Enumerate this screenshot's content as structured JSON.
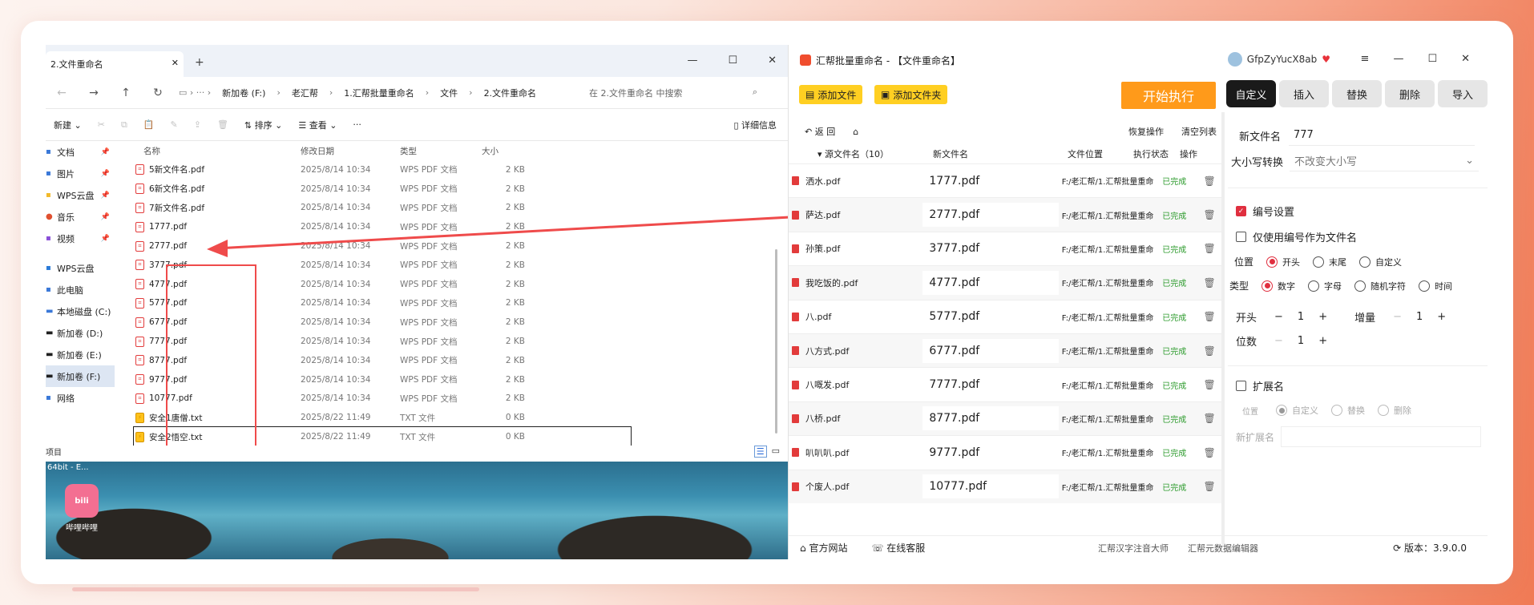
{
  "explorer": {
    "tab_title": "2.文件重命名",
    "tab_close": "✕",
    "new_tab": "+",
    "window_buttons": [
      "—",
      "☐",
      "✕"
    ],
    "breadcrumbs": [
      "新加卷 (F:)",
      "老汇帮",
      "1.汇帮批量重命名",
      "文件",
      "2.文件重命名"
    ],
    "search_placeholder": "在 2.文件重命名 中搜索",
    "commands": {
      "new": "新建",
      "sort": "排序",
      "view": "查看",
      "more": "···",
      "details": "详细信息"
    },
    "sidebar": [
      {
        "label": "文档",
        "icon": "document-icon",
        "pinned": true
      },
      {
        "label": "图片",
        "icon": "picture-icon",
        "pinned": true
      },
      {
        "label": "WPS云盘",
        "icon": "folder-icon",
        "pinned": true
      },
      {
        "label": "音乐",
        "icon": "music-icon",
        "pinned": true
      },
      {
        "label": "视频",
        "icon": "video-icon",
        "pinned": true
      },
      {
        "label": "WPS云盘",
        "icon": "cloud-icon",
        "pinned": false
      },
      {
        "label": "此电脑",
        "icon": "pc-icon",
        "pinned": false
      },
      {
        "label": "本地磁盘 (C:)",
        "icon": "drive-icon",
        "pinned": false
      },
      {
        "label": "新加卷 (D:)",
        "icon": "drive-icon",
        "pinned": false
      },
      {
        "label": "新加卷 (E:)",
        "icon": "drive-icon",
        "pinned": false
      },
      {
        "label": "新加卷 (F:)",
        "icon": "drive-icon",
        "pinned": false
      },
      {
        "label": "网络",
        "icon": "network-icon",
        "pinned": false
      }
    ],
    "columns": [
      "名称",
      "修改日期",
      "类型",
      "大小"
    ],
    "files": [
      {
        "name": "5新文件名.pdf",
        "date": "2025/8/14 10:34",
        "type": "WPS PDF 文档",
        "size": "2 KB",
        "kind": "pdf"
      },
      {
        "name": "6新文件名.pdf",
        "date": "2025/8/14 10:34",
        "type": "WPS PDF 文档",
        "size": "2 KB",
        "kind": "pdf"
      },
      {
        "name": "7新文件名.pdf",
        "date": "2025/8/14 10:34",
        "type": "WPS PDF 文档",
        "size": "2 KB",
        "kind": "pdf"
      },
      {
        "name": "1777.pdf",
        "date": "2025/8/14 10:34",
        "type": "WPS PDF 文档",
        "size": "2 KB",
        "kind": "pdf"
      },
      {
        "name": "2777.pdf",
        "date": "2025/8/14 10:34",
        "type": "WPS PDF 文档",
        "size": "2 KB",
        "kind": "pdf"
      },
      {
        "name": "3777.pdf",
        "date": "2025/8/14 10:34",
        "type": "WPS PDF 文档",
        "size": "2 KB",
        "kind": "pdf"
      },
      {
        "name": "4777.pdf",
        "date": "2025/8/14 10:34",
        "type": "WPS PDF 文档",
        "size": "2 KB",
        "kind": "pdf"
      },
      {
        "name": "5777.pdf",
        "date": "2025/8/14 10:34",
        "type": "WPS PDF 文档",
        "size": "2 KB",
        "kind": "pdf"
      },
      {
        "name": "6777.pdf",
        "date": "2025/8/14 10:34",
        "type": "WPS PDF 文档",
        "size": "2 KB",
        "kind": "pdf"
      },
      {
        "name": "7777.pdf",
        "date": "2025/8/14 10:34",
        "type": "WPS PDF 文档",
        "size": "2 KB",
        "kind": "pdf"
      },
      {
        "name": "8777.pdf",
        "date": "2025/8/14 10:34",
        "type": "WPS PDF 文档",
        "size": "2 KB",
        "kind": "pdf"
      },
      {
        "name": "9777.pdf",
        "date": "2025/8/14 10:34",
        "type": "WPS PDF 文档",
        "size": "2 KB",
        "kind": "pdf"
      },
      {
        "name": "10777.pdf",
        "date": "2025/8/14 10:34",
        "type": "WPS PDF 文档",
        "size": "2 KB",
        "kind": "pdf"
      },
      {
        "name": "安全1唐僧.txt",
        "date": "2025/8/22 11:49",
        "type": "TXT 文件",
        "size": "0 KB",
        "kind": "txt"
      },
      {
        "name": "安全2悟空.txt",
        "date": "2025/8/22 11:49",
        "type": "TXT 文件",
        "size": "0 KB",
        "kind": "txt"
      }
    ],
    "status_text": "项目",
    "desktop_label": "哔哩哔哩",
    "desktop_topline": "64bit - E..."
  },
  "app": {
    "title": "汇帮批量重命名 - 【文件重命名】",
    "username": "GfpZyYucX8ab",
    "window_buttons": [
      "≡",
      "—",
      "☐",
      "✕"
    ],
    "add_file": "添加文件",
    "add_folder": "添加文件夹",
    "start": "开始执行",
    "tabs": [
      "自定义",
      "插入",
      "替换",
      "删除",
      "导入"
    ],
    "back": "返 回",
    "restore": "恢复操作",
    "clear": "清空列表",
    "table_headers": {
      "source": "源文件名（10）",
      "newname": "新文件名",
      "location": "文件位置",
      "status": "执行状态",
      "op": "操作"
    },
    "rows": [
      {
        "src": "洒水.pdf",
        "new": "1777.pdf",
        "loc": "F:/老汇帮/1.汇帮批量重命",
        "status": "已完成"
      },
      {
        "src": "萨达.pdf",
        "new": "2777.pdf",
        "loc": "F:/老汇帮/1.汇帮批量重命",
        "status": "已完成"
      },
      {
        "src": "孙策.pdf",
        "new": "3777.pdf",
        "loc": "F:/老汇帮/1.汇帮批量重命",
        "status": "已完成"
      },
      {
        "src": "我吃饭的.pdf",
        "new": "4777.pdf",
        "loc": "F:/老汇帮/1.汇帮批量重命",
        "status": "已完成"
      },
      {
        "src": "八.pdf",
        "new": "5777.pdf",
        "loc": "F:/老汇帮/1.汇帮批量重命",
        "status": "已完成"
      },
      {
        "src": "八方式.pdf",
        "new": "6777.pdf",
        "loc": "F:/老汇帮/1.汇帮批量重命",
        "status": "已完成"
      },
      {
        "src": "八嘅发.pdf",
        "new": "7777.pdf",
        "loc": "F:/老汇帮/1.汇帮批量重命",
        "status": "已完成"
      },
      {
        "src": "八桥.pdf",
        "new": "8777.pdf",
        "loc": "F:/老汇帮/1.汇帮批量重命",
        "status": "已完成"
      },
      {
        "src": "叭叭叭.pdf",
        "new": "9777.pdf",
        "loc": "F:/老汇帮/1.汇帮批量重命",
        "status": "已完成"
      },
      {
        "src": "个废人.pdf",
        "new": "10777.pdf",
        "loc": "F:/老汇帮/1.汇帮批量重命",
        "status": "已完成"
      }
    ],
    "footer": {
      "website": "官方网站",
      "service": "在线客服",
      "link1": "汇帮汉字注音大师",
      "link2": "汇帮元数据编辑器",
      "version": "版本：3.9.0.0"
    },
    "panel": {
      "newname_label": "新文件名",
      "newname_value": "777",
      "case_label": "大小写转换",
      "case_value": "不改变大小写",
      "numbering_label": "编号设置",
      "numbering_checked": true,
      "use_number_label": "仅使用编号作为文件名",
      "position_label": "位置",
      "position_options": [
        "开头",
        "末尾",
        "自定义"
      ],
      "type_label": "类型",
      "type_options": [
        "数字",
        "字母",
        "随机字符",
        "时间"
      ],
      "start_label": "开头",
      "start_value": "1",
      "step_label": "增量",
      "step_value": "1",
      "digits_label": "位数",
      "digits_value": "1",
      "ext_label": "扩展名",
      "ext_pos_label": "位置",
      "ext_options": [
        "自定义",
        "替换",
        "删除"
      ],
      "new_ext_label": "新扩展名"
    }
  },
  "colors": {
    "accent_yellow": "#ffcf22",
    "start_orange": "#ff9a1a",
    "done_green": "#2d9b2d",
    "highlight_red": "#ef4b4b"
  }
}
